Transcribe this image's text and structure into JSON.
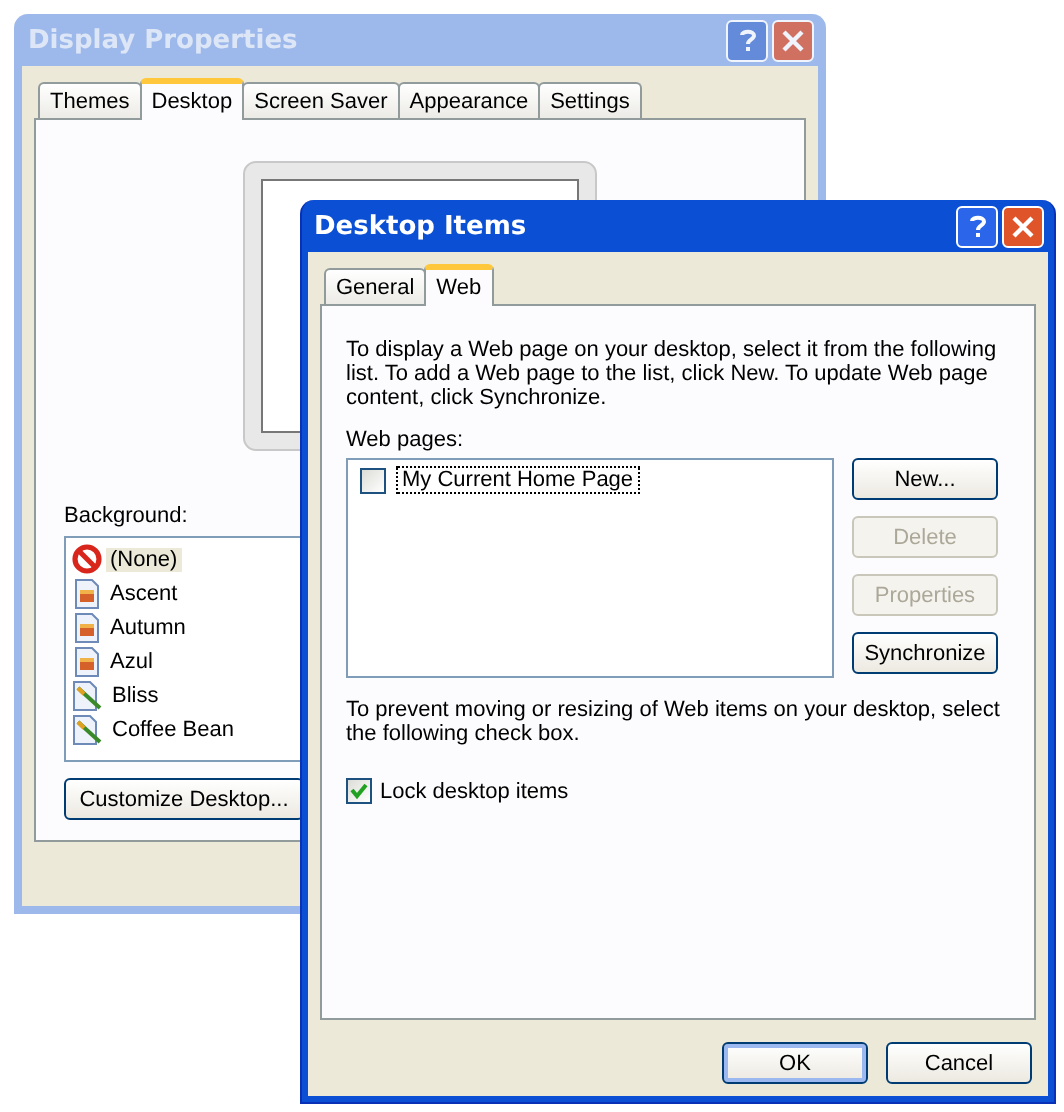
{
  "back_window": {
    "title": "Display Properties",
    "active": false,
    "tabs": [
      {
        "label": "Themes",
        "selected": false
      },
      {
        "label": "Desktop",
        "selected": true
      },
      {
        "label": "Screen Saver",
        "selected": false
      },
      {
        "label": "Appearance",
        "selected": false
      },
      {
        "label": "Settings",
        "selected": false
      }
    ],
    "background_label": "Background:",
    "backgrounds": [
      {
        "label": "(None)",
        "kind": "none",
        "selected": true
      },
      {
        "label": "Ascent",
        "kind": "image",
        "selected": false
      },
      {
        "label": "Autumn",
        "kind": "image",
        "selected": false
      },
      {
        "label": "Azul",
        "kind": "image",
        "selected": false
      },
      {
        "label": "Bliss",
        "kind": "drawing",
        "selected": false
      },
      {
        "label": "Coffee Bean",
        "kind": "drawing",
        "selected": false
      }
    ],
    "customize_button": "Customize Desktop..."
  },
  "front_window": {
    "title": "Desktop Items",
    "active": true,
    "tabs": [
      {
        "label": "General",
        "selected": false
      },
      {
        "label": "Web",
        "selected": true
      }
    ],
    "intro": "To display a Web page on your desktop, select it from the following list. To add a Web page to the list, click New.  To update Web page content, click Synchronize.",
    "web_pages_label": "Web pages:",
    "web_pages": [
      {
        "label": "My Current Home Page",
        "checked": false,
        "selected": true
      }
    ],
    "side_buttons": [
      {
        "label": "New...",
        "disabled": false
      },
      {
        "label": "Delete",
        "disabled": true
      },
      {
        "label": "Properties",
        "disabled": true
      },
      {
        "label": "Synchronize",
        "disabled": false
      }
    ],
    "lock_note": "To prevent moving or resizing of Web items on your desktop, select the following check box.",
    "lock_checkbox": {
      "label": "Lock desktop items",
      "checked": true
    },
    "dialog_buttons": [
      {
        "label": "OK",
        "default": true
      },
      {
        "label": "Cancel",
        "default": false
      }
    ]
  }
}
